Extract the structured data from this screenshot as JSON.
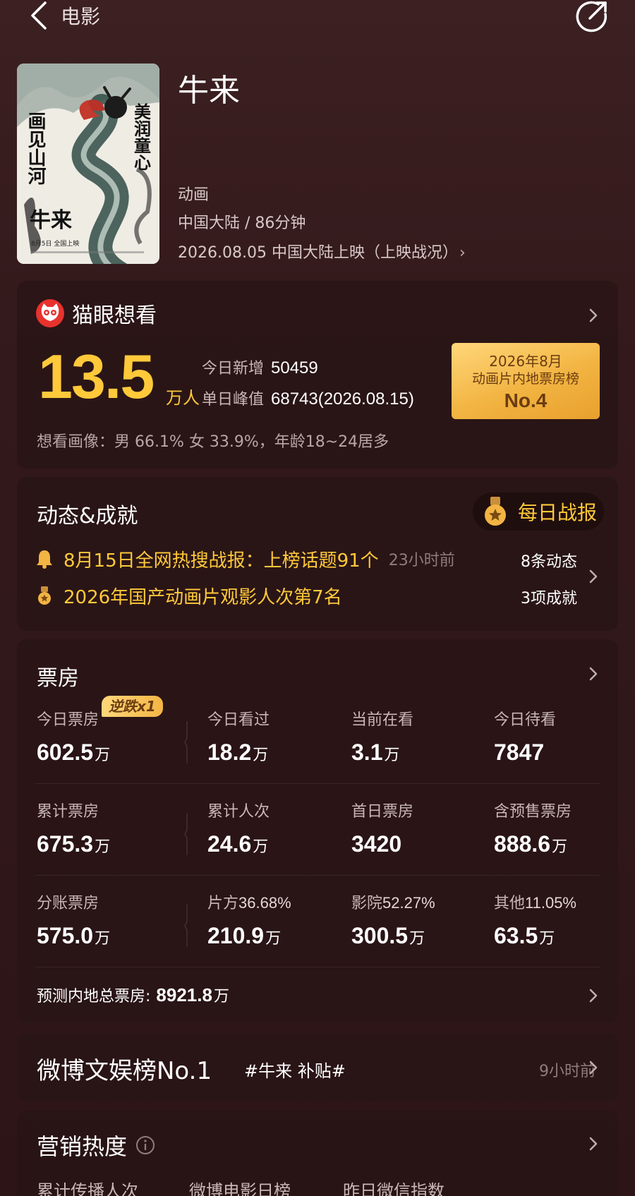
{
  "topbar": {
    "title": "电影",
    "icons": {
      "back": "back-chevron-icon",
      "share": "share-icon"
    }
  },
  "movie": {
    "poster": {
      "calligraphy_left": "画见山河",
      "calligraphy_right": "美润童心",
      "poster_title": "牛来",
      "poster_date": "8月5日 全国上映"
    },
    "title": "牛来",
    "genre": "动画",
    "region_duration": "中国大陆 / 86分钟",
    "release": "2026.08.05 中国大陆上映（上映战况）"
  },
  "maoyan": {
    "title": "猫眼想看",
    "count": "13.5",
    "count_unit": "万人",
    "today_label": "今日新增",
    "today_value": "50459",
    "peak_label": "单日峰值",
    "peak_value": "68743(2026.08.15)",
    "badge": {
      "line1": "2026年8月",
      "line2": "动画片内地票房榜",
      "rank": "No.4"
    },
    "portrait": "想看画像：男 66.1%  女 33.9%，年龄18~24居多"
  },
  "dynamics": {
    "title": "动态&成就",
    "daily_button": "每日战报",
    "items": [
      {
        "text": "8月15日全网热搜战报：上榜话题91个",
        "time": "23小时前",
        "count": "8条动态",
        "icon": "bell-icon"
      },
      {
        "text": "2026年国产动画片观影人次第7名",
        "time": "",
        "count": "3项成就",
        "icon": "medal-icon"
      }
    ]
  },
  "box_office": {
    "title": "票房",
    "reverse_badge": "逆跌x1",
    "rows": [
      [
        {
          "label": "今日票房",
          "value": "602.5",
          "unit": "万"
        },
        {
          "label": "今日看过",
          "value": "18.2",
          "unit": "万"
        },
        {
          "label": "当前在看",
          "value": "3.1",
          "unit": "万"
        },
        {
          "label": "今日待看",
          "value": "7847",
          "unit": ""
        }
      ],
      [
        {
          "label": "累计票房",
          "value": "675.3",
          "unit": "万"
        },
        {
          "label": "累计人次",
          "value": "24.6",
          "unit": "万"
        },
        {
          "label": "首日票房",
          "value": "3420",
          "unit": ""
        },
        {
          "label": "含预售票房",
          "value": "888.6",
          "unit": "万"
        }
      ],
      [
        {
          "label": "分账票房",
          "pct": "",
          "value": "575.0",
          "unit": "万"
        },
        {
          "label": "片方",
          "pct": "36.68%",
          "value": "210.9",
          "unit": "万"
        },
        {
          "label": "影院",
          "pct": "52.27%",
          "value": "300.5",
          "unit": "万"
        },
        {
          "label": "其他",
          "pct": "11.05%",
          "value": "63.5",
          "unit": "万"
        }
      ]
    ],
    "forecast_label": "预测内地总票房:",
    "forecast_value": "8921.8",
    "forecast_unit": "万"
  },
  "weibo": {
    "title": "微博文娱榜No.1",
    "tag": "#牛来 补贴#",
    "time": "9小时前"
  },
  "marketing": {
    "title": "营销热度",
    "labels": [
      "累计传播人次",
      "微博电影日榜",
      "昨日微信指数"
    ]
  },
  "colors": {
    "background": "#33191b",
    "accent_gold": "#ffc93a",
    "card": "#2a1517",
    "muted_text": "#c9b6b6"
  }
}
